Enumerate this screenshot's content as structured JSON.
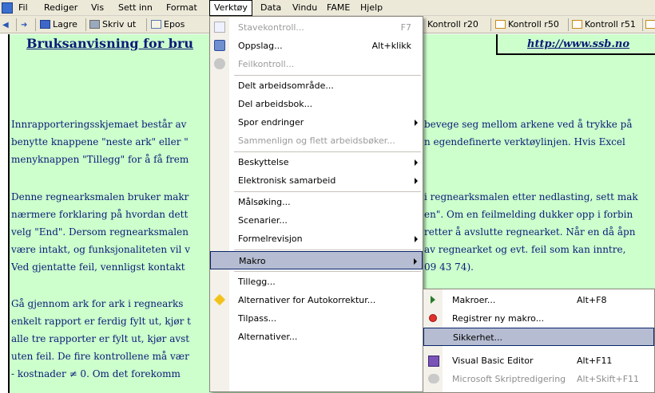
{
  "menubar": {
    "app_icon": "excel-doc-icon",
    "items": [
      "Fil",
      "Rediger",
      "Vis",
      "Sett inn",
      "Format",
      "Verktøy",
      "Data",
      "Vindu",
      "FAME",
      "Hjelp"
    ]
  },
  "toolbar": {
    "back_icon": "back-arrow-icon",
    "forward_icon": "forward-arrow-icon",
    "save_label": "Lagre",
    "print_label": "Skriv ut",
    "mail_label": "Epos",
    "kontroll_labels": [
      "Kontroll r20",
      "Kontroll r50",
      "Kontroll r51"
    ]
  },
  "sheet": {
    "title": "Bruksanvisning for bru",
    "url": "http://www.ssb.no",
    "left_lines": [
      "Innrapporteringsskjemaet består av",
      "benytte knappene \"neste ark\" eller \"",
      "menyknappen \"Tillegg\" for å få frem",
      "Denne regnearksmalen bruker makr",
      "nærmere forklaring på hvordan dett",
      "velg \"End\". Dersom regnearksmalen",
      "være intakt, og funksjonaliteten vil v",
      "Ved gjentatte feil, vennligst kontakt",
      "Gå gjennom ark for ark i regnearks",
      "enkelt rapport er ferdig fylt ut, kjør t",
      "alle tre rapporter er fylt ut, kjør avst",
      "uten feil. De fire kontrollene må vær",
      "- kostnader ≠ 0. Om det forekomm"
    ],
    "right_lines": [
      "bevege seg mellom arkene ved å trykke på",
      "n egendefinerte verktøylinjen. Hvis  Excel",
      "i regnearksmalen etter nedlasting, sett mak",
      "en\". Om en feilmelding dukker opp i forbin",
      "retter å avslutte regnearket. Når en då åpn",
      " av regnearket og evt. feil som kan inntre,",
      "09 43 74)."
    ]
  },
  "tools_menu": {
    "items": [
      {
        "label": "Stavekontroll...",
        "shortcut": "F7",
        "icon": "spellcheck-icon",
        "disabled": true
      },
      {
        "label": "Oppslag...",
        "shortcut": "Alt+klikk",
        "icon": "research-icon"
      },
      {
        "label": "Feilkontroll...",
        "icon": "error-check-icon",
        "disabled": true
      },
      {
        "label": "Delt arbeidsområde..."
      },
      {
        "label": "Del arbeidsbok..."
      },
      {
        "label": "Spor endringer",
        "submenu": true
      },
      {
        "label": "Sammenlign og flett arbeidsbøker...",
        "disabled": true
      },
      {
        "label": "Beskyttelse",
        "submenu": true
      },
      {
        "label": "Elektronisk samarbeid",
        "submenu": true
      },
      {
        "label": "Målsøking..."
      },
      {
        "label": "Scenarier..."
      },
      {
        "label": "Formelrevisjon",
        "submenu": true
      },
      {
        "label": "Makro",
        "submenu": true,
        "highlighted": true
      },
      {
        "label": "Tillegg..."
      },
      {
        "label": "Alternativer for Autokorrektur...",
        "icon": "autocorrect-icon"
      },
      {
        "label": "Tilpass..."
      },
      {
        "label": "Alternativer..."
      }
    ]
  },
  "macro_submenu": {
    "items": [
      {
        "label": "Makroer...",
        "shortcut": "Alt+F8",
        "icon": "play-icon"
      },
      {
        "label": "Registrer ny makro...",
        "icon": "record-icon"
      },
      {
        "label": "Sikkerhet...",
        "highlighted": true
      },
      {
        "label": "Visual Basic Editor",
        "shortcut": "Alt+F11",
        "icon": "vbe-icon"
      },
      {
        "label": "Microsoft Skriptredigering",
        "shortcut": "Alt+Skift+F11",
        "icon": "script-editor-icon",
        "disabled": true
      }
    ]
  },
  "colors": {
    "sheet_bg": "#ccffcc",
    "text_blue": "#0b1a78",
    "highlight_bg": "#b6bdd2",
    "highlight_border": "#0a246a",
    "chrome": "#ece9d8"
  }
}
